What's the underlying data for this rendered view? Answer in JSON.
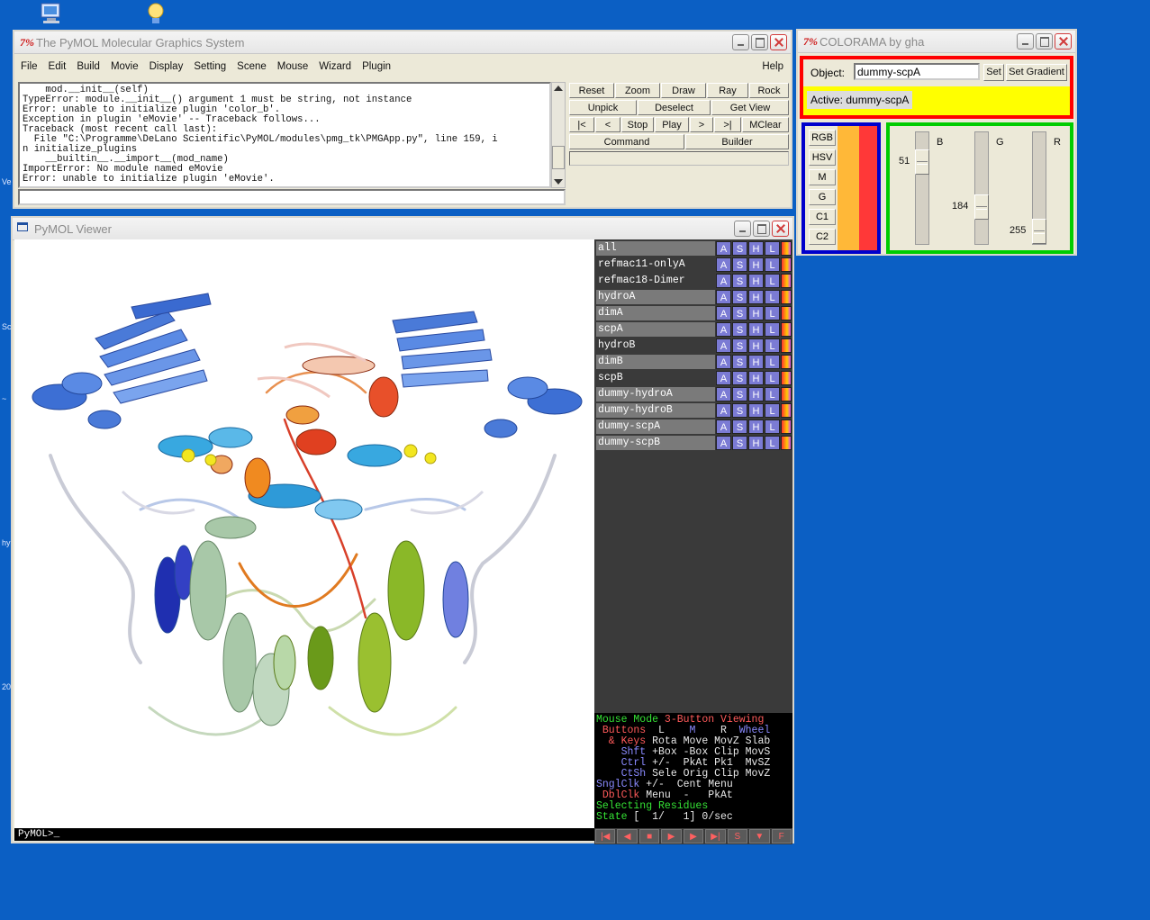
{
  "desktop": {
    "edge_labels": [
      "Ve",
      "Sc",
      "~",
      "hy",
      "20"
    ]
  },
  "main_window": {
    "title": "The PyMOL Molecular Graphics System",
    "menu": [
      "File",
      "Edit",
      "Build",
      "Movie",
      "Display",
      "Setting",
      "Scene",
      "Mouse",
      "Wizard",
      "Plugin"
    ],
    "help": "Help",
    "console_lines": [
      "    mod.__init__(self)",
      "TypeError: module.__init__() argument 1 must be string, not instance",
      "Error: unable to initialize plugin 'color_b'.",
      "Exception in plugin 'eMovie' -- Traceback follows...",
      "Traceback (most recent call last):",
      "  File \"C:\\Programme\\DeLano Scientific\\PyMOL/modules\\pmg_tk\\PMGApp.py\", line 159, i",
      "n initialize_plugins",
      "    __builtin__.__import__(mod_name)",
      "ImportError: No module named eMovie",
      "Error: unable to initialize plugin 'eMovie'."
    ],
    "buttons": {
      "row1": [
        "Reset",
        "Zoom",
        "Draw",
        "Ray",
        "Rock"
      ],
      "row2": [
        "Unpick",
        "Deselect",
        "Get View"
      ],
      "row3": [
        "|<",
        "<",
        "Stop",
        "Play",
        ">",
        ">|",
        "MClear"
      ],
      "row4": [
        "Command",
        "Builder"
      ]
    }
  },
  "viewer": {
    "title": "PyMOL Viewer",
    "prompt": "PyMOL>_",
    "objects": [
      {
        "name": "all",
        "dark": false
      },
      {
        "name": "refmac11-onlyA",
        "dark": true
      },
      {
        "name": "refmac18-Dimer",
        "dark": true
      },
      {
        "name": "hydroA",
        "dark": false
      },
      {
        "name": "dimA",
        "dark": false
      },
      {
        "name": "scpA",
        "dark": false
      },
      {
        "name": "hydroB",
        "dark": true
      },
      {
        "name": "dimB",
        "dark": false
      },
      {
        "name": "scpB",
        "dark": true
      },
      {
        "name": "dummy-hydroA",
        "dark": false
      },
      {
        "name": "dummy-hydroB",
        "dark": false
      },
      {
        "name": "dummy-scpA",
        "dark": false
      },
      {
        "name": "dummy-scpB",
        "dark": false
      }
    ],
    "object_buttons": [
      "A",
      "S",
      "H",
      "L",
      "C"
    ],
    "mouse_info": {
      "line1_a": "Mouse Mode ",
      "line1_b": "3-Button Viewing",
      "line2_a": " Buttons  ",
      "line2_b": "L",
      "line2_c": "    M    ",
      "line2_d": "R",
      "line2_e": "  Wheel",
      "rows": [
        {
          "k": "  & Keys ",
          "v": "Rota Move MovZ Slab",
          "kc": "r"
        },
        {
          "k": "    Shft ",
          "v": "+Box -Box Clip MovS",
          "kc": "b"
        },
        {
          "k": "    Ctrl ",
          "v": "+/-  PkAt Pk1  MvSZ",
          "kc": "b"
        },
        {
          "k": "    CtSh ",
          "v": "Sele Orig Clip MovZ",
          "kc": "b"
        },
        {
          "k": "SnglClk ",
          "v": "+/-  Cent Menu",
          "kc": "b"
        },
        {
          "k": " DblClk ",
          "v": "Menu  -   PkAt",
          "kc": "r"
        }
      ],
      "selecting": "Selecting Residues",
      "state_label": "State",
      "state_value": " [  1/   1] 0/sec"
    },
    "transport": [
      "|◀",
      "◀",
      "■",
      "▶",
      "▶",
      "▶|",
      "S",
      "▼",
      "F"
    ]
  },
  "colorama": {
    "title": "COLORAMA by gha",
    "object_label": "Object:",
    "object_value": "dummy-scpA",
    "set_button": "Set",
    "set_gradient_button": "Set Gradient",
    "active_label": "Active:",
    "active_value": "dummy-scpA",
    "modes": [
      "RGB",
      "HSV",
      "M",
      "G",
      "C1",
      "C2"
    ],
    "swatch_colors": [
      "#ffb838",
      "#ff3838"
    ],
    "sliders": [
      {
        "label": "B",
        "value": "51"
      },
      {
        "label": "G",
        "value": "184"
      },
      {
        "label": "R",
        "value": "255"
      }
    ],
    "frame_colors": {
      "top": "#ff0000",
      "left": "#0000cc",
      "right": "#00cc00",
      "active_bg": "#ffff00"
    }
  }
}
